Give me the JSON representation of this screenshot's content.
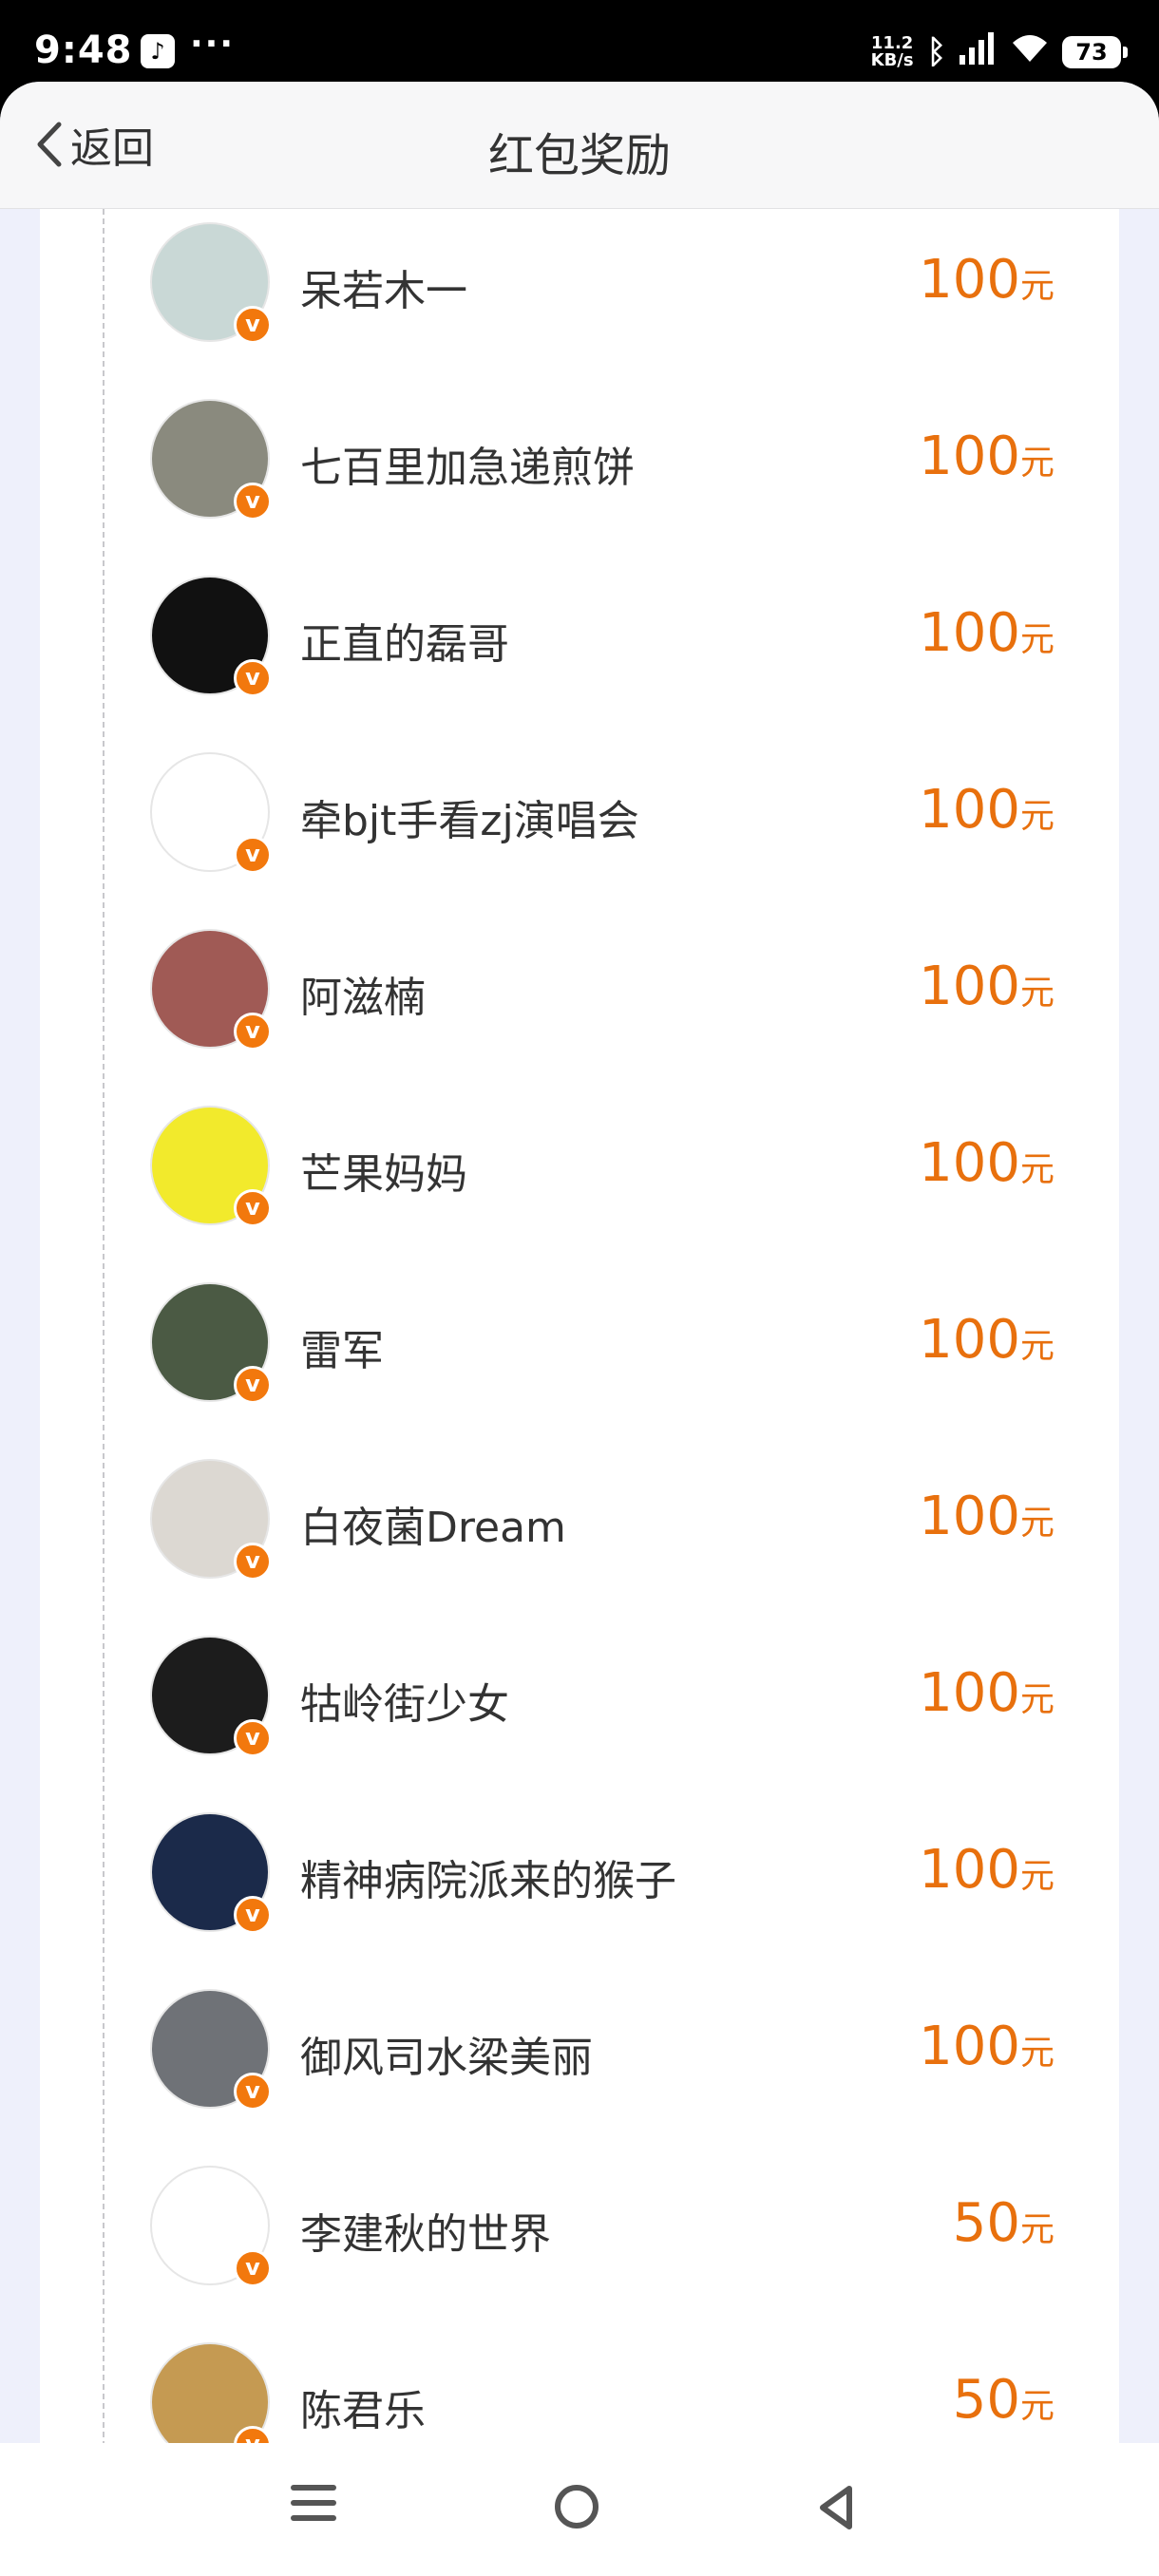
{
  "status_bar": {
    "time": "9:48",
    "app_icon": "tiktok-icon",
    "more": "···",
    "speed_value": "11.2",
    "speed_unit": "KB/s",
    "battery": "73"
  },
  "header": {
    "back_label": "返回",
    "title": "红包奖励"
  },
  "rows": [
    {
      "name": "呆若木一",
      "amount": "100",
      "unit": "元",
      "avatar_color": "#c9d8d6"
    },
    {
      "name": "七百里加急递煎饼",
      "amount": "100",
      "unit": "元",
      "avatar_color": "#8a8a7e"
    },
    {
      "name": "正直的磊哥",
      "amount": "100",
      "unit": "元",
      "avatar_color": "#111111"
    },
    {
      "name": "牵bjt手看zj演唱会",
      "amount": "100",
      "unit": "元",
      "avatar_color": "#ffffff"
    },
    {
      "name": "阿滋楠",
      "amount": "100",
      "unit": "元",
      "avatar_color": "#a05a55"
    },
    {
      "name": "芒果妈妈",
      "amount": "100",
      "unit": "元",
      "avatar_color": "#f2ea2c"
    },
    {
      "name": "雷军",
      "amount": "100",
      "unit": "元",
      "avatar_color": "#4b5a44"
    },
    {
      "name": "白夜菌Dream",
      "amount": "100",
      "unit": "元",
      "avatar_color": "#dcd8d2"
    },
    {
      "name": "牯岭街少女",
      "amount": "100",
      "unit": "元",
      "avatar_color": "#1c1c1c"
    },
    {
      "name": "精神病院派来的猴子",
      "amount": "100",
      "unit": "元",
      "avatar_color": "#1b2a4a"
    },
    {
      "name": "御风司水梁美丽",
      "amount": "100",
      "unit": "元",
      "avatar_color": "#6f7277"
    },
    {
      "name": "李建秋的世界",
      "amount": "50",
      "unit": "元",
      "avatar_color": "#ffffff"
    },
    {
      "name": "陈君乐",
      "amount": "50",
      "unit": "元",
      "avatar_color": "#c59a52"
    }
  ],
  "badge_label": "v",
  "colors": {
    "accent": "#e8700d",
    "badge": "#f2780d",
    "background": "#eef0fb"
  }
}
